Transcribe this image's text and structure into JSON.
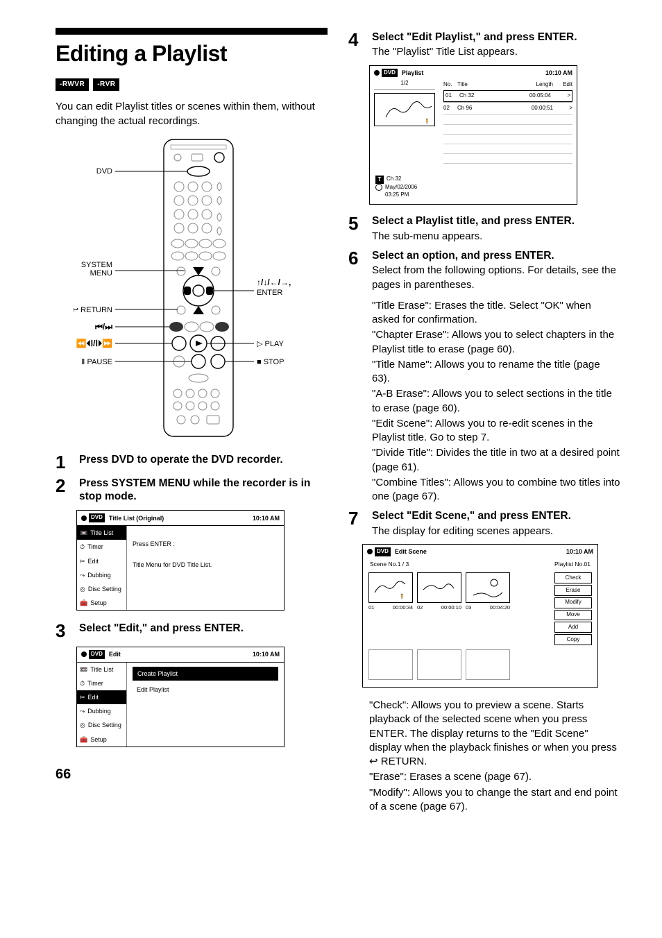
{
  "page_number": "66",
  "title": "Editing a Playlist",
  "badges": [
    "-RWVR",
    "-RVR"
  ],
  "intro": "You can edit Playlist titles or scenes within them, without changing the actual recordings.",
  "remote_labels": {
    "dvd": "DVD",
    "system_menu": "SYSTEM MENU",
    "return": "RETURN",
    "prev_next": "⏮/⏭",
    "scan_step": "⏪⏴Ⅰ/Ⅰ⏵⏩",
    "pause": "Ⅱ PAUSE",
    "arrows_enter": "↑/↓/←/→, ENTER",
    "play": "▷ PLAY",
    "stop": "■ STOP"
  },
  "steps": {
    "s1": {
      "head": "Press DVD to operate the DVD recorder."
    },
    "s2": {
      "head": "Press SYSTEM MENU while the recorder is in stop mode."
    },
    "s3": {
      "head": "Select \"Edit,\" and press ENTER."
    },
    "s4": {
      "head": "Select \"Edit Playlist,\" and press ENTER.",
      "sub": "The \"Playlist\" Title List appears."
    },
    "s5": {
      "head": "Select a Playlist title, and press ENTER.",
      "sub": "The sub-menu appears."
    },
    "s6": {
      "head": "Select an option, and press ENTER.",
      "sub": "Select from the following options. For details, see the pages in parentheses.",
      "opts": [
        "\"Title Erase\": Erases the title. Select \"OK\" when asked for confirmation.",
        "\"Chapter Erase\": Allows you to select chapters in the Playlist title to erase (page 60).",
        "\"Title Name\": Allows you to rename the title (page 63).",
        "\"A-B Erase\": Allows you to select sections in the title to erase (page 60).",
        "\"Edit Scene\": Allows you to re-edit scenes in the Playlist title. Go to step 7.",
        "\"Divide Title\": Divides the title in two at a desired point (page 61).",
        "\"Combine Titles\": Allows you to combine two titles into one (page 67)."
      ]
    },
    "s7": {
      "head": "Select \"Edit Scene,\" and press ENTER.",
      "sub": "The display for editing scenes appears.",
      "after": [
        "\"Check\": Allows you to preview a scene. Starts playback of the selected scene when you press ENTER. The display returns to the \"Edit Scene\" display when the playback finishes or when you press ↩ RETURN.",
        "\"Erase\": Erases a scene (page 67).",
        "\"Modify\": Allows you to change the start and end point of a scene (page 67)."
      ]
    }
  },
  "osd_titlelist": {
    "title": "Title List (Original)",
    "time": "10:10 AM",
    "side": [
      "Title List",
      "Timer",
      "Edit",
      "Dubbing",
      "Disc Setting",
      "Setup"
    ],
    "selected": 0,
    "main_line1": "Press ENTER :",
    "main_line2": "Title Menu for DVD Title List."
  },
  "osd_edit": {
    "title": "Edit",
    "time": "10:10 AM",
    "side": [
      "Title List",
      "Timer",
      "Edit",
      "Dubbing",
      "Disc Setting",
      "Setup"
    ],
    "selected": 2,
    "rows": [
      "Create Playlist",
      "Edit Playlist"
    ],
    "row_selected": 0
  },
  "osd_playlist": {
    "title": "Playlist",
    "time": "10:10 AM",
    "pager": "1/2",
    "head": {
      "no": "No.",
      "title": "Title",
      "length": "Length",
      "edit": "Edit"
    },
    "rows": [
      {
        "no": "01",
        "title": "Ch 32",
        "length": "00:05:04",
        "edit": ">",
        "sel": true
      },
      {
        "no": "02",
        "title": "Ch 96",
        "length": "00:00:51",
        "edit": ">"
      }
    ],
    "info_title": "Ch 32",
    "info_date": "May/02/2006",
    "info_time": "03:25  PM"
  },
  "osd_scene": {
    "title": "Edit Scene",
    "time": "10:10 AM",
    "sub_left": "Scene No.1 / 3",
    "sub_right": "Playlist No.01",
    "scenes": [
      {
        "no": "01",
        "time": "00:00:34"
      },
      {
        "no": "02",
        "time": "00:00:10"
      },
      {
        "no": "03",
        "time": "00:04:20"
      }
    ],
    "buttons": [
      "Check",
      "Erase",
      "Modify",
      "Move",
      "Add",
      "Copy"
    ]
  }
}
